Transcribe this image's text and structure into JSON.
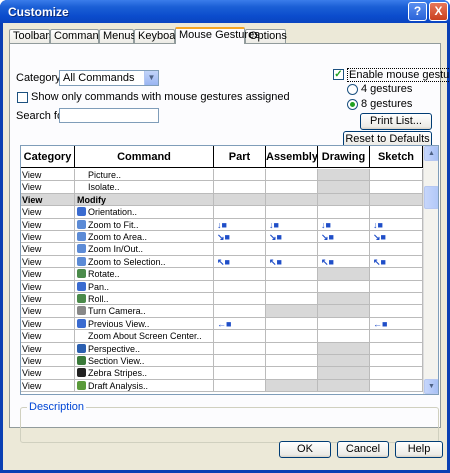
{
  "window": {
    "title": "Customize",
    "help_label": "?",
    "close_label": "X"
  },
  "tabs": [
    "Toolbars",
    "Commands",
    "Menus",
    "Keyboard",
    "Mouse Gestures",
    "Options"
  ],
  "active_tab": "Mouse Gestures",
  "category": {
    "label": "Category:",
    "value": "All Commands"
  },
  "show_only": {
    "label": "Show only commands with mouse gestures assigned",
    "checked": false
  },
  "search": {
    "label": "Search for:",
    "value": ""
  },
  "enable_gestures": {
    "label": "Enable mouse gestures",
    "checked": true
  },
  "gesture_count": {
    "options": [
      "4 gestures",
      "8 gestures"
    ],
    "selected": "8 gestures"
  },
  "buttons": {
    "print_list": "Print List...",
    "reset_defaults": "Reset to Defaults",
    "ok": "OK",
    "cancel": "Cancel",
    "help": "Help"
  },
  "table": {
    "columns": [
      "Category",
      "Command",
      "Part",
      "Assembly",
      "Drawing",
      "Sketch"
    ],
    "rows": [
      {
        "category": "View",
        "command": "Picture..",
        "indent": 2,
        "gray": [
          false,
          false,
          true,
          false
        ]
      },
      {
        "category": "View",
        "command": "Isolate..",
        "indent": 2,
        "gray": [
          false,
          false,
          true,
          false
        ]
      },
      {
        "category": "View",
        "command": "Modify",
        "indent": 0,
        "section": true
      },
      {
        "category": "View",
        "command": "Orientation..",
        "icon": "orientation-icon",
        "icon_color": "#3a6bd0",
        "gray": [
          false,
          false,
          false,
          false
        ]
      },
      {
        "category": "View",
        "command": "Zoom to Fit..",
        "icon": "zoom-fit-icon",
        "icon_color": "#5c8bd6",
        "gestures": [
          "↓■",
          "↓■",
          "↓■",
          "↓■"
        ]
      },
      {
        "category": "View",
        "command": "Zoom to Area..",
        "icon": "zoom-area-icon",
        "icon_color": "#5c8bd6",
        "gestures": [
          "↘■",
          "↘■",
          "↘■",
          "↘■"
        ]
      },
      {
        "category": "View",
        "command": "Zoom In/Out..",
        "icon": "zoom-in-out-icon",
        "icon_color": "#5c8bd6",
        "gestures": [
          "",
          "",
          "",
          ""
        ]
      },
      {
        "category": "View",
        "command": "Zoom to Selection..",
        "icon": "zoom-selection-icon",
        "icon_color": "#5c8bd6",
        "gestures": [
          "↖■",
          "↖■",
          "↖■",
          "↖■"
        ]
      },
      {
        "category": "View",
        "command": "Rotate..",
        "icon": "rotate-icon",
        "icon_color": "#4a8a4a",
        "gray": [
          false,
          false,
          true,
          false
        ]
      },
      {
        "category": "View",
        "command": "Pan..",
        "icon": "pan-icon",
        "icon_color": "#3a6bd0",
        "gray": [
          false,
          false,
          false,
          false
        ]
      },
      {
        "category": "View",
        "command": "Roll..",
        "icon": "roll-icon",
        "icon_color": "#4a8a4a",
        "gray": [
          false,
          false,
          true,
          false
        ]
      },
      {
        "category": "View",
        "command": "Turn Camera..",
        "icon": "turn-camera-icon",
        "icon_color": "#888888",
        "gray": [
          false,
          true,
          true,
          false
        ]
      },
      {
        "category": "View",
        "command": "Previous View..",
        "icon": "previous-view-icon",
        "icon_color": "#3a6bd0",
        "gestures": [
          "←■",
          "",
          "",
          "←■"
        ]
      },
      {
        "category": "View",
        "command": "Zoom About Screen Center..",
        "indent": 2,
        "gray": [
          false,
          false,
          false,
          false
        ]
      },
      {
        "category": "View",
        "command": "Perspective..",
        "icon": "perspective-icon",
        "icon_color": "#2b5fb0",
        "gray": [
          false,
          false,
          true,
          false
        ]
      },
      {
        "category": "View",
        "command": "Section View..",
        "icon": "section-view-icon",
        "icon_color": "#3a7a3a",
        "gray": [
          false,
          false,
          true,
          false
        ]
      },
      {
        "category": "View",
        "command": "Zebra Stripes..",
        "icon": "zebra-stripes-icon",
        "icon_color": "#222222",
        "gray": [
          false,
          false,
          true,
          false
        ]
      },
      {
        "category": "View",
        "command": "Draft Analysis..",
        "icon": "draft-analysis-icon",
        "icon_color": "#5a9a3a",
        "gray": [
          false,
          true,
          true,
          false
        ]
      }
    ]
  },
  "description": {
    "label": "Description",
    "text": ""
  }
}
